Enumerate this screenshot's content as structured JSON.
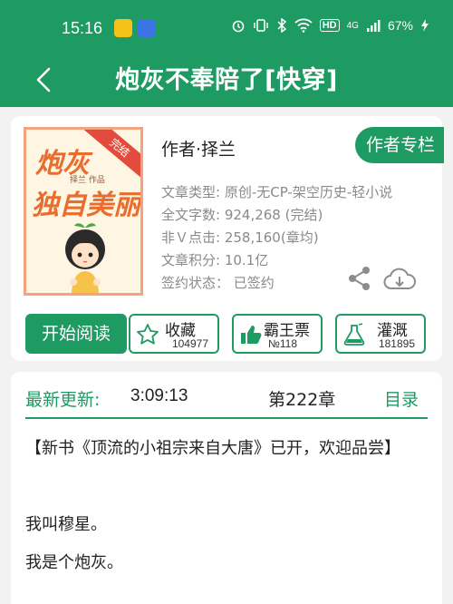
{
  "status": {
    "time": "15:16",
    "hd": "HD",
    "net": "4G",
    "battery": "67%"
  },
  "header": {
    "title": "炮灰不奉陪了[快穿]"
  },
  "book": {
    "cover_ribbon": "完结",
    "cover_title_1": "炮灰",
    "cover_author_small": "择兰 作品",
    "cover_title_2": "独自美丽",
    "author": "作者·择兰",
    "column_button": "作者专栏",
    "type": "文章类型: 原创-无CP-架空历史-轻小说",
    "word_count": "全文字数: 924,268 (完结)",
    "clicks": "非Ｖ点击: 258,160(章均)",
    "score": "文章积分: 10.1亿",
    "contract": "签约状态：  已签约"
  },
  "actions": {
    "start": "开始阅读",
    "favorite_label": "收藏",
    "favorite_count": "104977",
    "ticket_label": "霸王票",
    "ticket_count": "№118",
    "water_label": "灌溉",
    "water_count": "181895"
  },
  "update": {
    "label": "最新更新:",
    "time": "3:09:13",
    "chapter": "第222章",
    "toc": "目录"
  },
  "content": {
    "p1": "【新书《顶流的小祖宗来自大唐》已开，欢迎品尝】",
    "p2": "",
    "p3": "我叫穆星。",
    "p4": "我是个炮灰。"
  },
  "colors": {
    "brand": "#1e9a63",
    "cover_border": "#f3a37e",
    "cover_title": "#e96d2e"
  }
}
